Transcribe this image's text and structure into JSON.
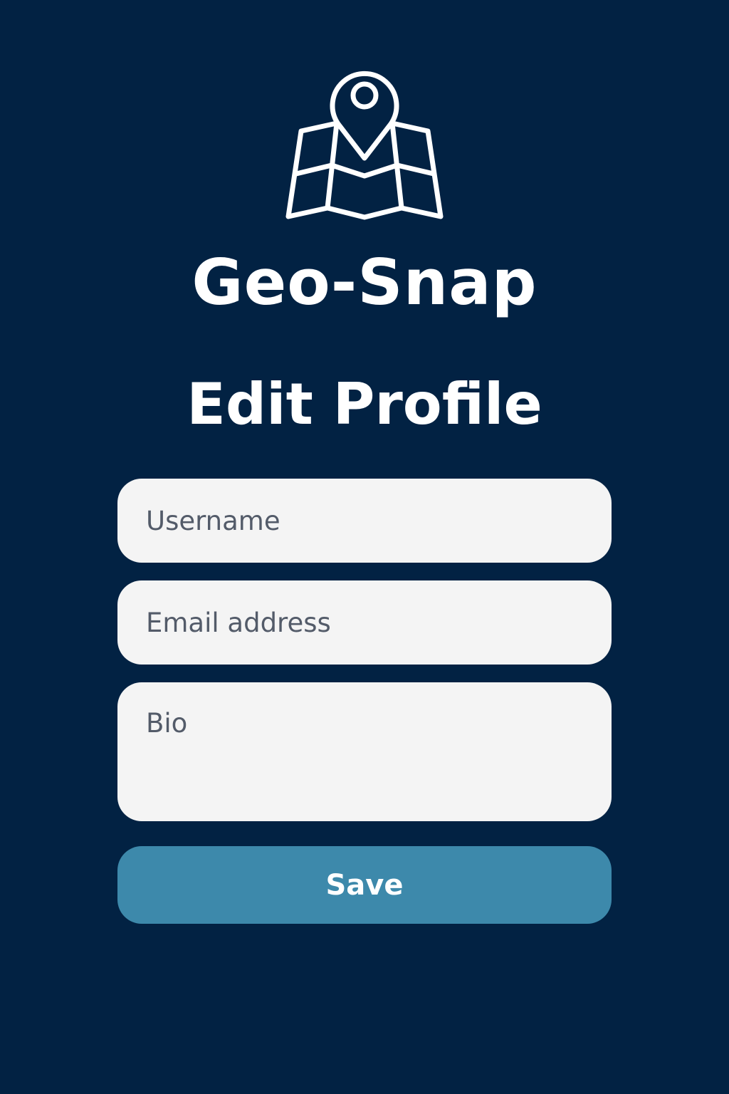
{
  "app": {
    "title": "Geo-Snap",
    "logo_icon": "map-pin-icon"
  },
  "page": {
    "title": "Edit Profile"
  },
  "form": {
    "username": {
      "placeholder": "Username",
      "value": ""
    },
    "email": {
      "placeholder": "Email address",
      "value": ""
    },
    "bio": {
      "placeholder": "Bio",
      "value": ""
    },
    "save_label": "Save"
  },
  "colors": {
    "background": "#022243",
    "field_background": "#f4f4f4",
    "accent": "#3d89ab",
    "text_light": "#ffffff",
    "placeholder": "#535b69"
  }
}
